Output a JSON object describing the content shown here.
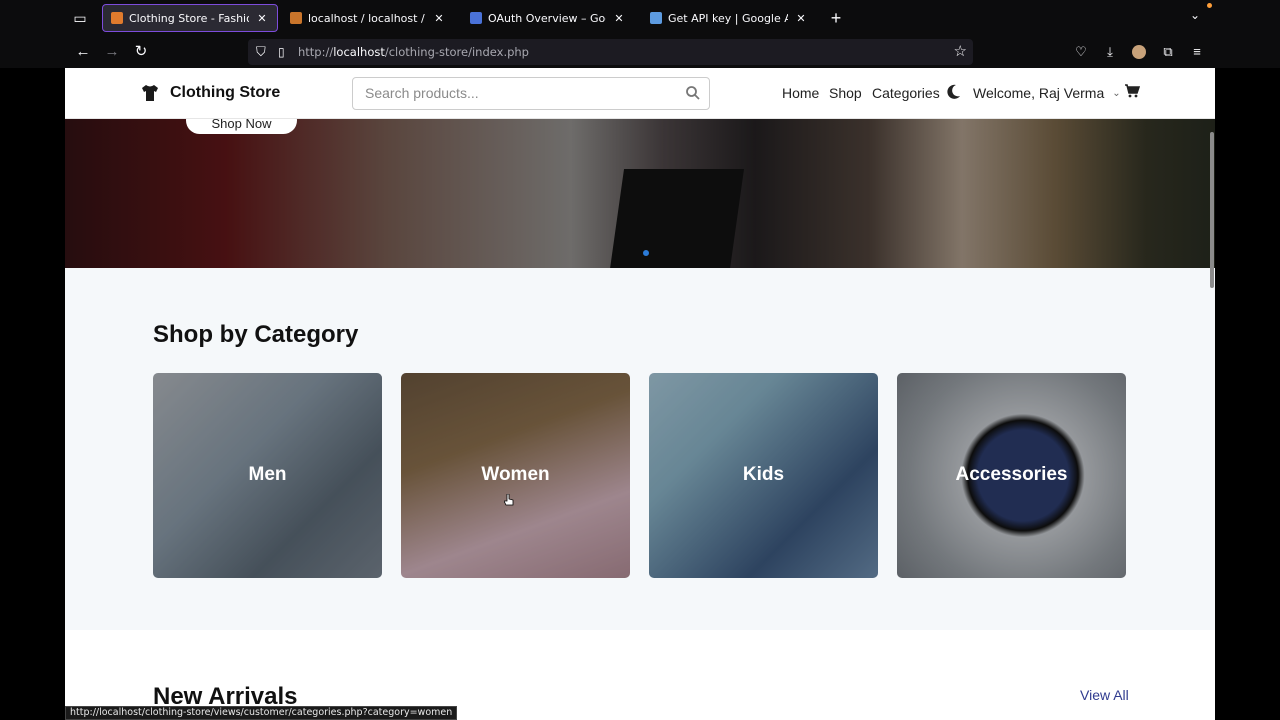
{
  "browser": {
    "tabs": [
      {
        "title": "Clothing Store - Fashion & Lifes",
        "active": true,
        "favicon_color": "#e07b2d"
      },
      {
        "title": "localhost / localhost / clothing_",
        "active": false,
        "favicon_color": "#c9752b"
      },
      {
        "title": "OAuth Overview – Google Auth",
        "active": false,
        "favicon_color": "#4a72d8"
      },
      {
        "title": "Get API key | Google AI Studio",
        "active": false,
        "favicon_color": "#5d9be0"
      }
    ],
    "url_prefix": "http://",
    "url_host": "localhost",
    "url_path": "/clothing-store/index.php",
    "status_url": "http://localhost/clothing-store/views/customer/categories.php?category=women"
  },
  "header": {
    "brand": "Clothing Store",
    "search_placeholder": "Search products...",
    "nav": [
      "Home",
      "Shop",
      "Categories"
    ],
    "welcome": "Welcome, Raj Verma"
  },
  "hero": {
    "button": "Shop Now"
  },
  "categories": {
    "title": "Shop by Category",
    "items": [
      {
        "label": "Men",
        "color_a": "#8a9aa8",
        "color_b": "#5d6b78"
      },
      {
        "label": "Women",
        "color_a": "#8b6f4d",
        "color_b": "#c9a6b0"
      },
      {
        "label": "Kids",
        "color_a": "#8ab3c7",
        "color_b": "#3d5a80"
      },
      {
        "label": "Accessories",
        "color_a": "#9aa0a6",
        "color_b": "#2c3c6e"
      }
    ]
  },
  "arrivals": {
    "title": "New Arrivals",
    "view_all": "View All"
  },
  "colors": {
    "accent": "#2f3a8f",
    "active_tab_border": "#7d4cdb"
  }
}
